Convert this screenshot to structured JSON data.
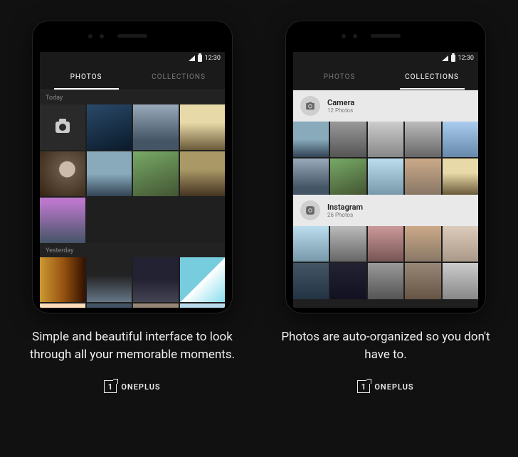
{
  "statusbar": {
    "time": "12:30"
  },
  "tabs": {
    "photos": "PHOTOS",
    "collections": "COLLECTIONS"
  },
  "left": {
    "active_tab": "photos",
    "sections": {
      "today": "Today",
      "yesterday": "Yesterday"
    },
    "caption": "Simple and beautiful interface to look through all your memorable moments."
  },
  "right": {
    "active_tab": "collections",
    "albums": {
      "camera": {
        "title": "Camera",
        "subtitle": "12 Photos"
      },
      "instagram": {
        "title": "Instagram",
        "subtitle": "26 Photos"
      }
    },
    "caption": "Photos are auto-organized so you don't have to."
  },
  "brand": {
    "name": "ONEPLUS",
    "mark": "1"
  }
}
